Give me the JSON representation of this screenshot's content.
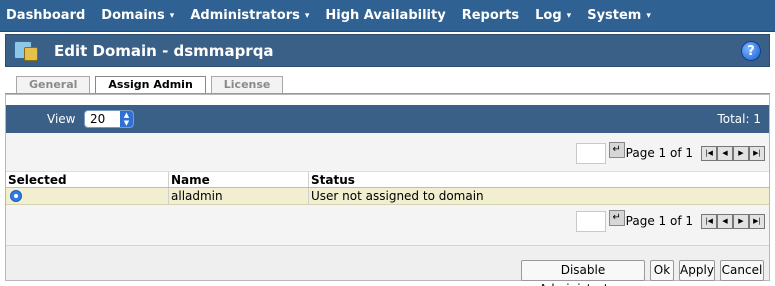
{
  "nav": {
    "items": [
      {
        "label": "Dashboard",
        "dropdown": false
      },
      {
        "label": "Domains",
        "dropdown": true
      },
      {
        "label": "Administrators",
        "dropdown": true
      },
      {
        "label": "High Availability",
        "dropdown": false
      },
      {
        "label": "Reports",
        "dropdown": false
      },
      {
        "label": "Log",
        "dropdown": true
      },
      {
        "label": "System",
        "dropdown": true
      }
    ],
    "caret": "▾"
  },
  "header": {
    "title": "Edit Domain - dsmmaprqa",
    "help": "?"
  },
  "tabs": [
    {
      "label": "General",
      "active": false
    },
    {
      "label": "Assign Admin",
      "active": true
    },
    {
      "label": "License",
      "active": false
    }
  ],
  "viewbar": {
    "view_label": "View",
    "view_value": "20",
    "total": "Total: 1"
  },
  "pager": {
    "page_text": "Page 1 of 1",
    "go": "↵",
    "first": "|◀",
    "prev": "◀",
    "next": "▶",
    "last": "▶|"
  },
  "table": {
    "columns": [
      "Selected",
      "Name",
      "Status"
    ],
    "rows": [
      {
        "selected": true,
        "name": "alladmin",
        "status": "User not assigned to domain"
      }
    ]
  },
  "buttons": {
    "disable": "Disable Administrators",
    "ok": "Ok",
    "apply": "Apply",
    "cancel": "Cancel"
  },
  "colors": {
    "nav_bg": "#2f6192",
    "title_bg": "#3b6087",
    "row_highlight": "#f1efcf"
  }
}
